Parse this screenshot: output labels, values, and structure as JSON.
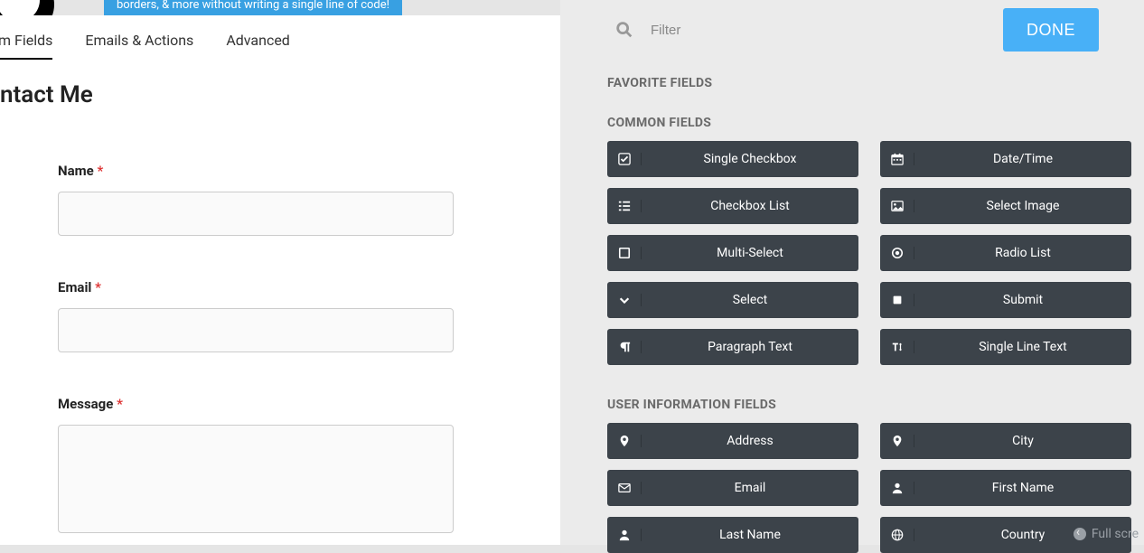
{
  "banner": "borders, & more without writing a single line of code!",
  "tabs": [
    {
      "label": "m Fields",
      "active": true
    },
    {
      "label": "Emails & Actions",
      "active": false
    },
    {
      "label": "Advanced",
      "active": false
    }
  ],
  "form_title": "ntact Me",
  "form_fields": [
    {
      "label": "Name",
      "required": true,
      "type": "text"
    },
    {
      "label": "Email",
      "required": true,
      "type": "text"
    },
    {
      "label": "Message",
      "required": true,
      "type": "textarea"
    }
  ],
  "filter": {
    "placeholder": "Filter"
  },
  "done": "DONE",
  "sections": {
    "favorite": {
      "heading": "FAVORITE FIELDS"
    },
    "common": {
      "heading": "COMMON FIELDS",
      "left": [
        "Single Checkbox",
        "Checkbox List",
        "Multi-Select",
        "Select",
        "Paragraph Text"
      ],
      "right": [
        "Date/Time",
        "Select Image",
        "Radio List",
        "Submit",
        "Single Line Text"
      ]
    },
    "user": {
      "heading": "USER INFORMATION FIELDS",
      "left": [
        "Address",
        "Email",
        "Last Name"
      ],
      "right": [
        "City",
        "First Name",
        "Country"
      ]
    }
  },
  "icons": {
    "common_left": [
      "check-square",
      "list",
      "stop",
      "chevron-down",
      "paragraph"
    ],
    "common_right": [
      "calendar",
      "image",
      "dot-circle",
      "square-filled",
      "text-height"
    ],
    "user_left": [
      "map-marker",
      "envelope",
      "user"
    ],
    "user_right": [
      "map-marker",
      "user",
      "globe"
    ]
  },
  "fullscreen": "Full scre"
}
